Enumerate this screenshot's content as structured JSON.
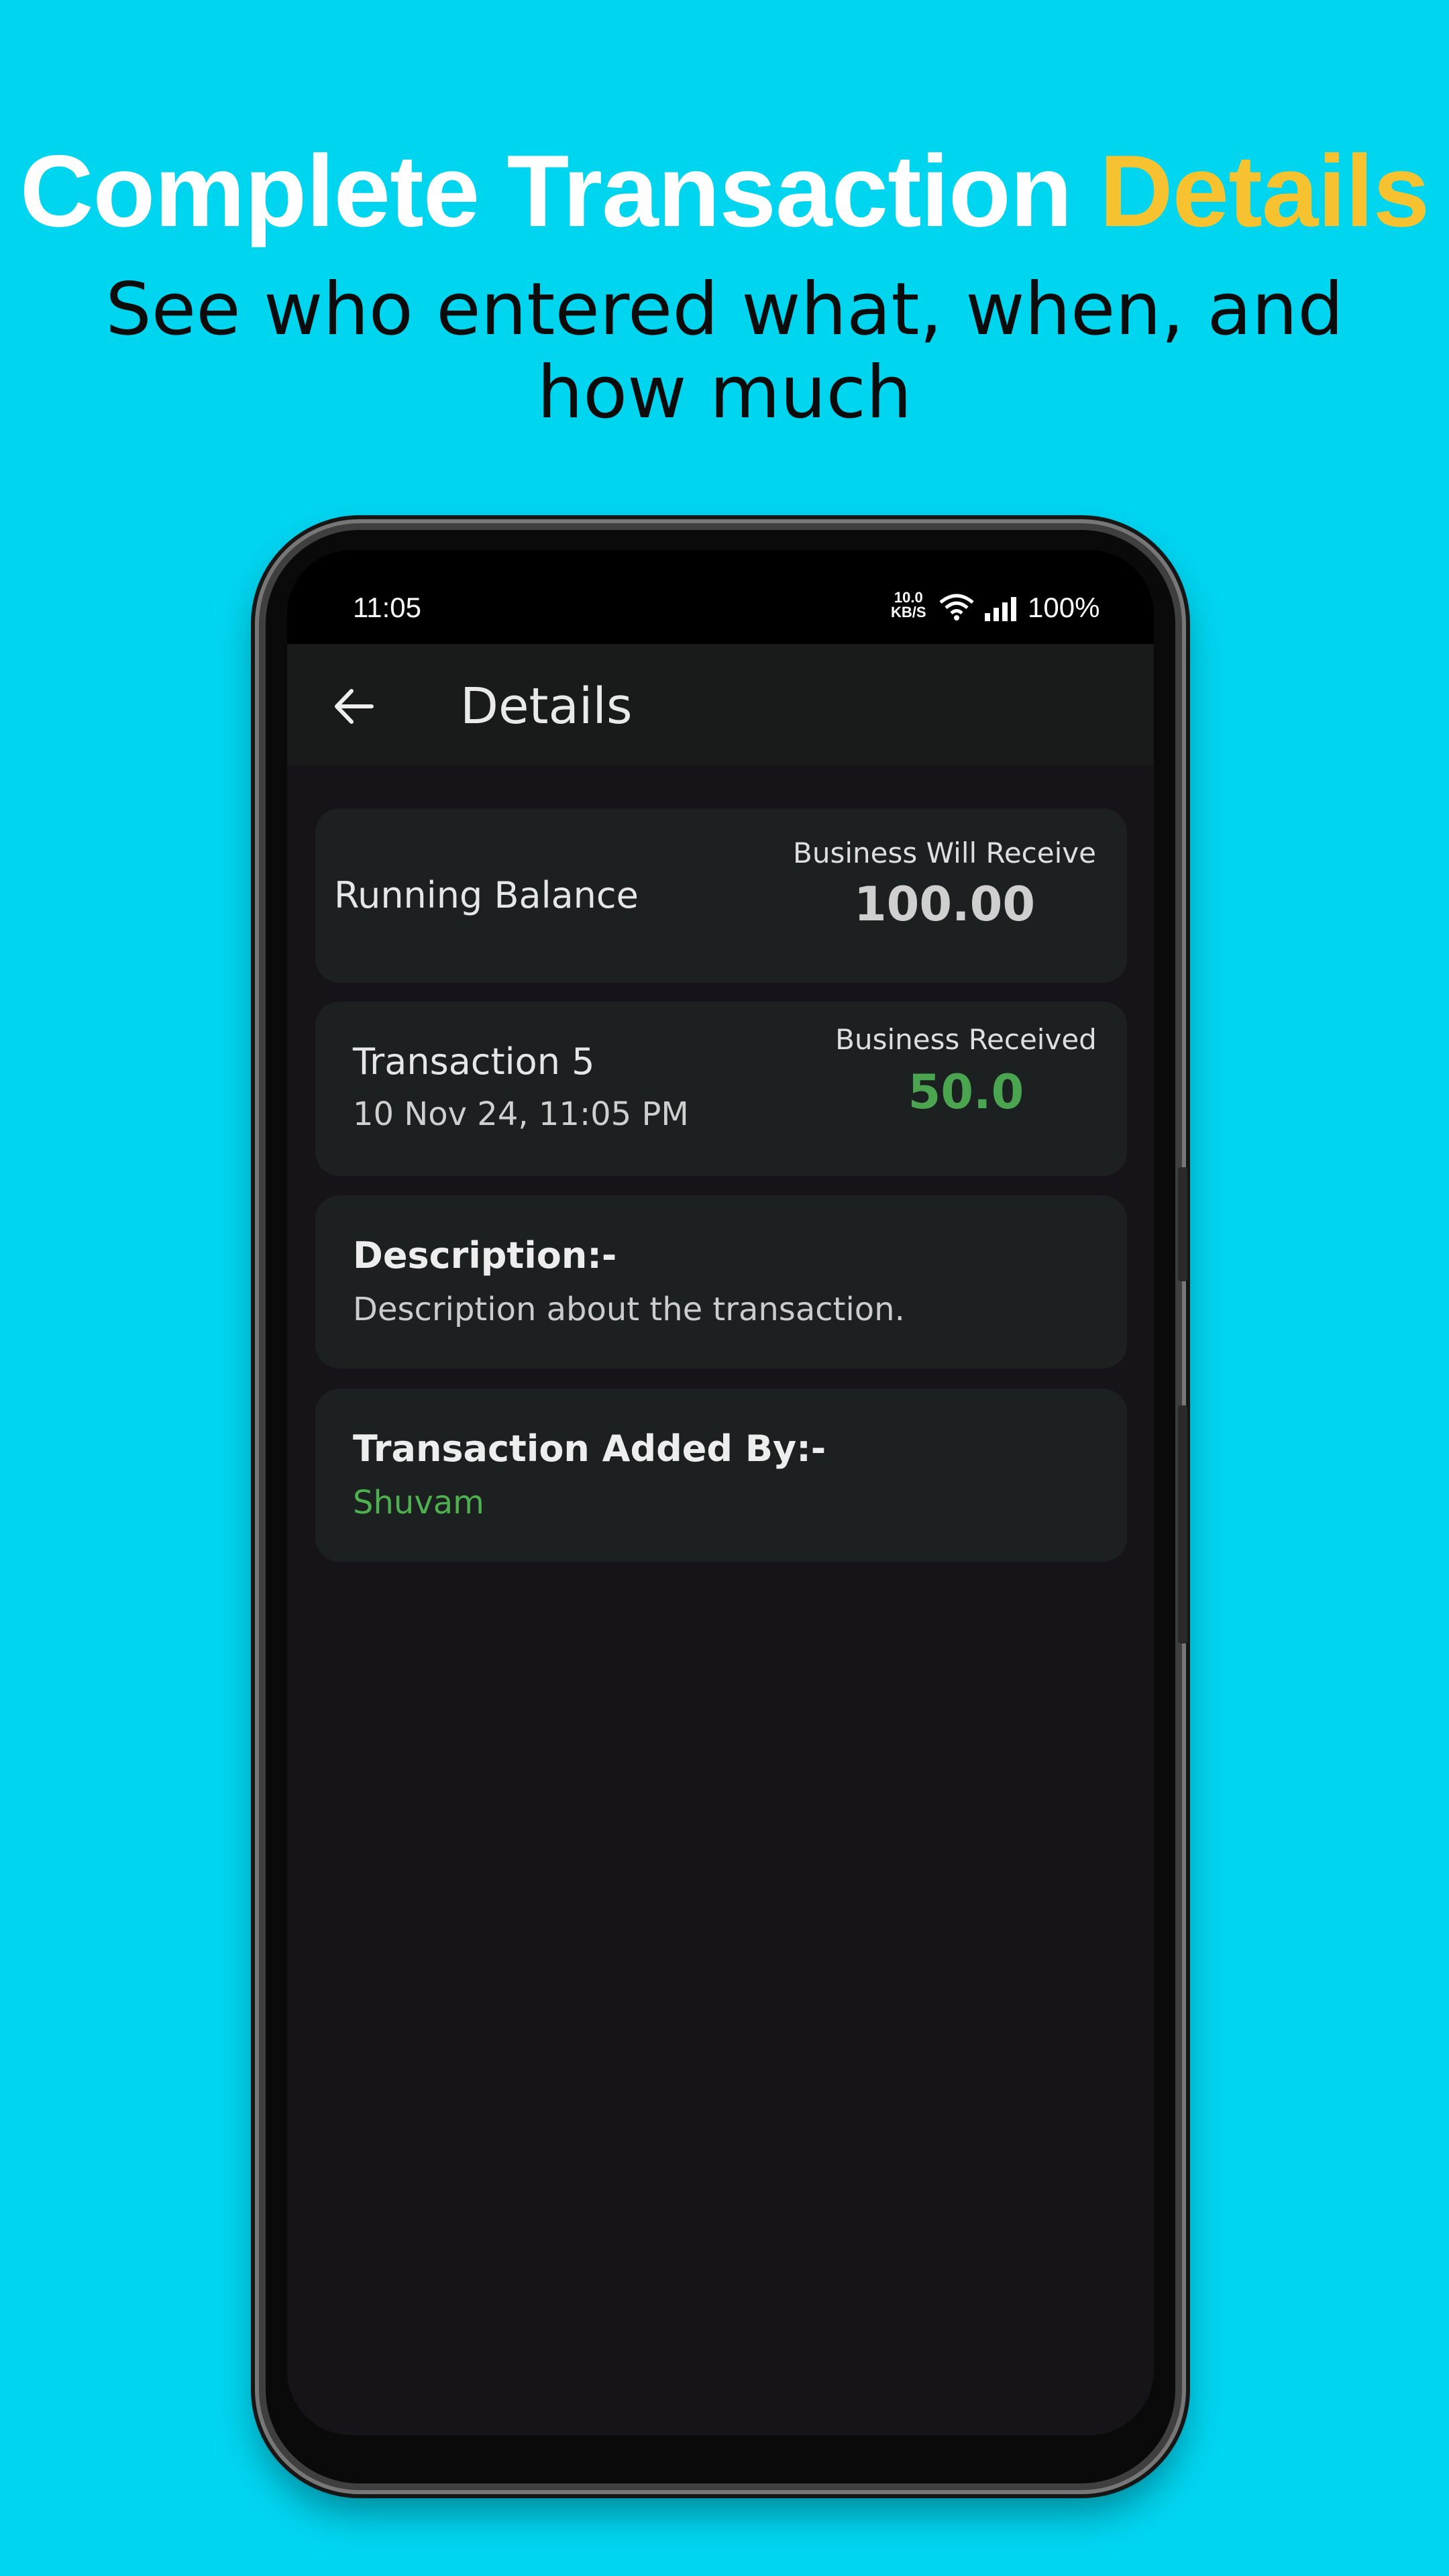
{
  "promo": {
    "headline_main": "Complete Transaction",
    "headline_accent": "Details",
    "subheadline": "See who entered what, when, and how much"
  },
  "status_bar": {
    "time": "11:05",
    "net_speed_value": "10.0",
    "net_speed_unit": "KB/S",
    "battery": "100%"
  },
  "app_bar": {
    "title": "Details"
  },
  "running_balance_card": {
    "label": "Running Balance",
    "status_label": "Business Will Receive",
    "amount": "100.00"
  },
  "transaction_card": {
    "title": "Transaction 5",
    "date": "10 Nov 24, 11:05 PM",
    "status_label": "Business Received",
    "amount": "50.0"
  },
  "description_card": {
    "heading": "Description:-",
    "text": "Description about the transaction."
  },
  "added_by_card": {
    "heading": "Transaction Added By:-",
    "name": "Shuvam"
  },
  "colors": {
    "background": "#00d5f0",
    "accent": "#f7c22f",
    "positive_amount": "#4ba44f",
    "added_by_name": "#4eb04f",
    "card": "#1c2020",
    "screen": "#161419"
  }
}
